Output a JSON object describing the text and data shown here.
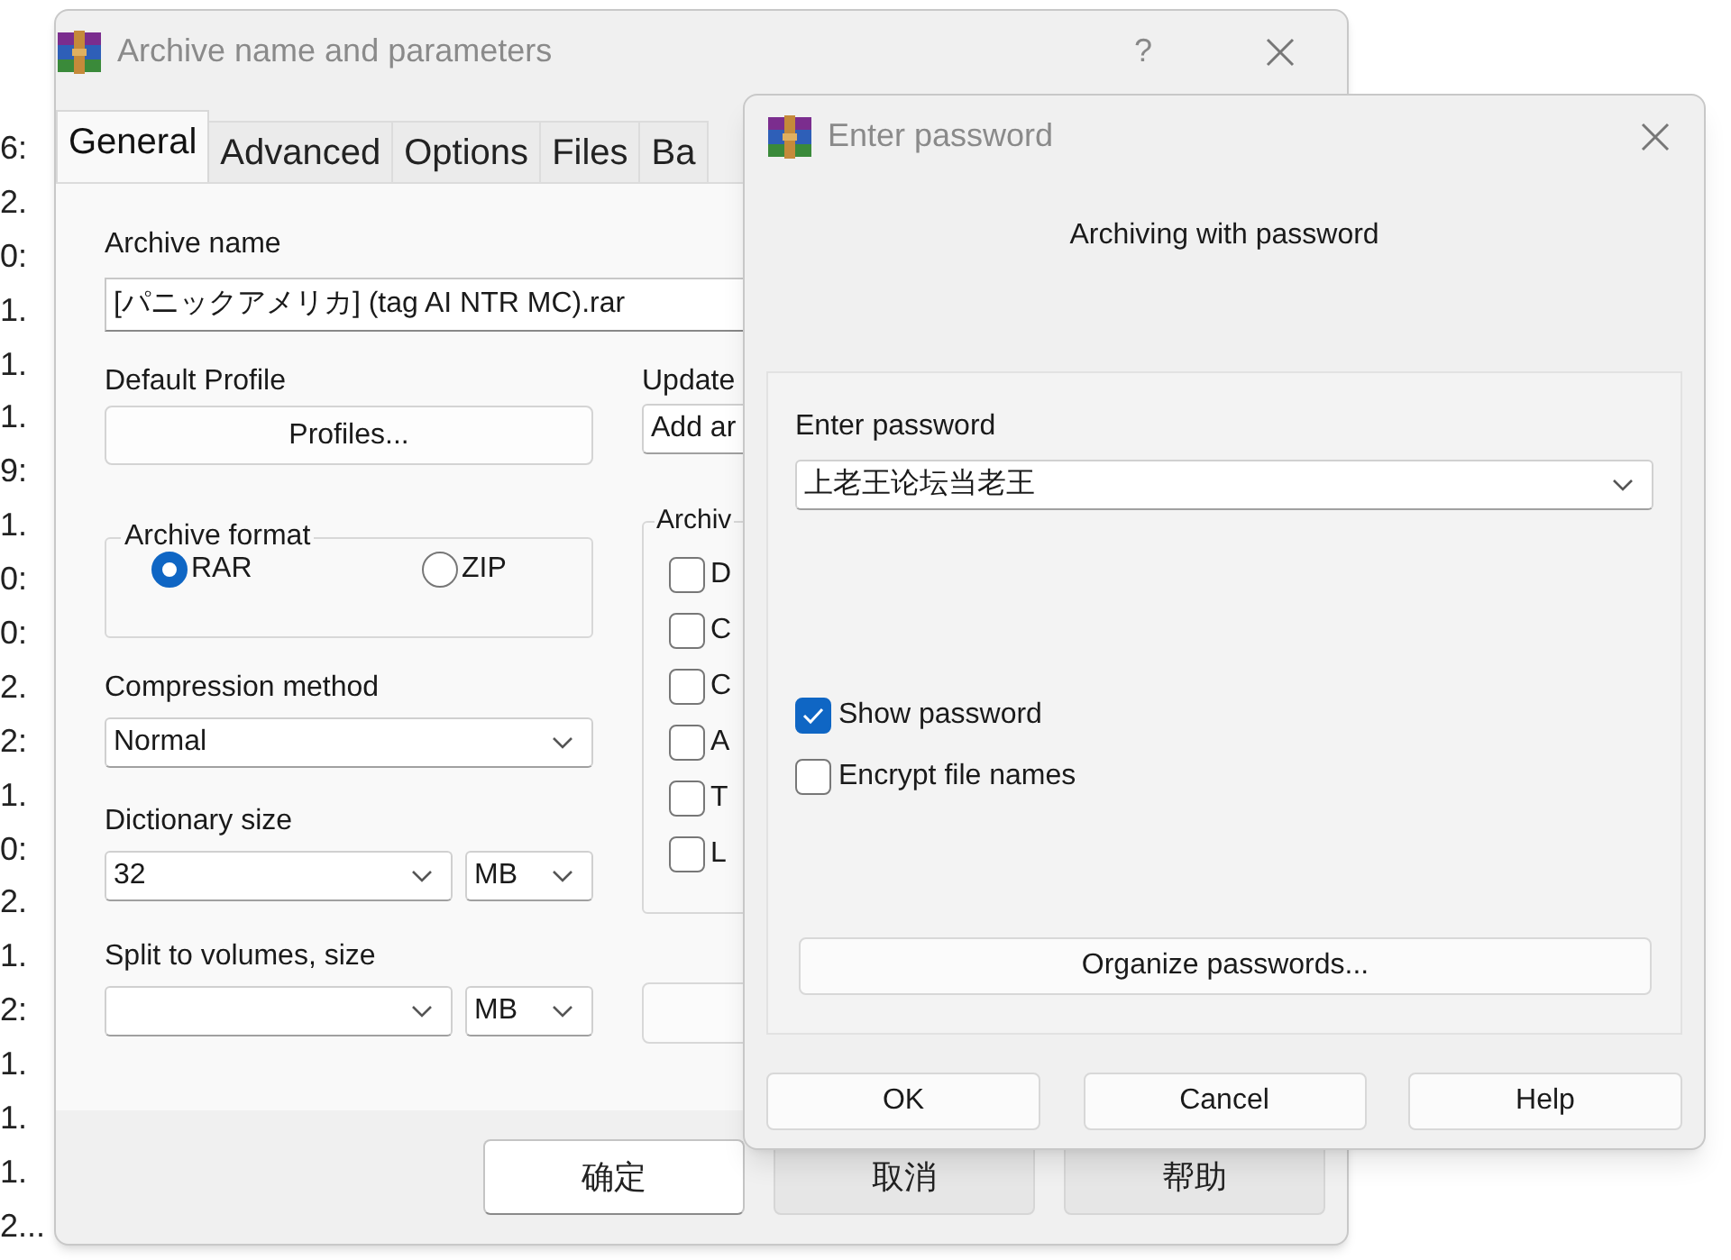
{
  "background_list": [
    "6:",
    "2.",
    "0:",
    "1.",
    "1.",
    "1.",
    "9:",
    "1.",
    "0:",
    "0:",
    "2.",
    "2:",
    "1.",
    "0:",
    "2.",
    "1.",
    "2:",
    "1.",
    "1.",
    "1.",
    "2..."
  ],
  "main_window": {
    "title": "Archive name and parameters",
    "help_glyph": "?",
    "tabs": [
      {
        "label": "General",
        "selected": true
      },
      {
        "label": "Advanced",
        "selected": false
      },
      {
        "label": "Options",
        "selected": false
      },
      {
        "label": "Files",
        "selected": false
      },
      {
        "label": "Ba",
        "selected": false
      }
    ],
    "archive_name": {
      "label": "Archive name",
      "value": "[パニックアメリカ] (tag AI NTR MC).rar"
    },
    "default_profile": {
      "label": "Default Profile",
      "button": "Profiles..."
    },
    "archive_format": {
      "label": "Archive format",
      "options": [
        {
          "label": "RAR",
          "selected": true
        },
        {
          "label": "ZIP",
          "selected": false
        }
      ]
    },
    "compression_method": {
      "label": "Compression method",
      "value": "Normal"
    },
    "dictionary_size": {
      "label": "Dictionary size",
      "value": "32",
      "unit": "MB"
    },
    "split_volumes": {
      "label": "Split to volumes, size",
      "unit": "MB"
    },
    "update_mode": {
      "label": "Update",
      "value": "Add ar"
    },
    "archiving_options": {
      "label": "Archiv",
      "options": [
        {
          "label": "D",
          "checked": false
        },
        {
          "label": "C",
          "checked": false
        },
        {
          "label": "C",
          "checked": false
        },
        {
          "label": "A",
          "checked": false
        },
        {
          "label": "T",
          "checked": false
        },
        {
          "label": "L",
          "checked": false
        }
      ]
    },
    "buttons": [
      {
        "label": "确定",
        "default": true
      },
      {
        "label": "取消",
        "default": false
      },
      {
        "label": "帮助",
        "default": false
      }
    ]
  },
  "password_dialog": {
    "title": "Enter password",
    "heading": "Archiving with password",
    "field": {
      "label": "Enter password",
      "value": "上老王论坛当老王"
    },
    "options": [
      {
        "label": "Show password",
        "checked": true
      },
      {
        "label": "Encrypt file names",
        "checked": false
      }
    ],
    "organize_button": "Organize passwords...",
    "buttons": [
      "OK",
      "Cancel",
      "Help"
    ]
  }
}
